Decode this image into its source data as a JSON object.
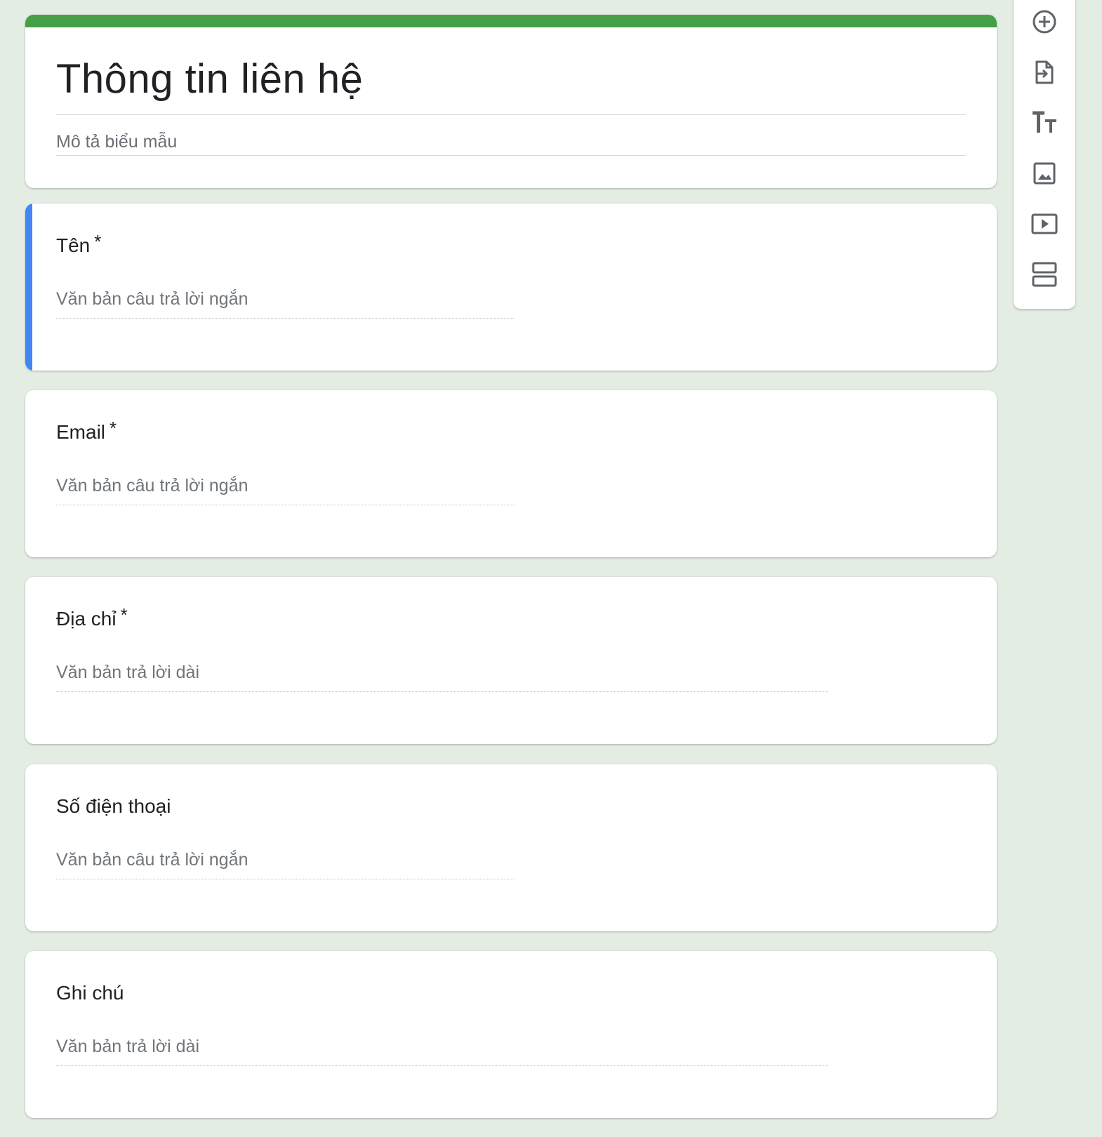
{
  "form": {
    "title": "Thông tin liên hệ",
    "description": "Mô tả biểu mẫu",
    "accent_color": "#43a047",
    "active_color": "#4285f4"
  },
  "questions": [
    {
      "title": "Tên",
      "required_mark": "*",
      "answer_placeholder": "Văn bản câu trả lời ngắn",
      "type": "short"
    },
    {
      "title": "Email",
      "required_mark": "*",
      "answer_placeholder": "Văn bản câu trả lời ngắn",
      "type": "short"
    },
    {
      "title": "Địa chỉ",
      "required_mark": "*",
      "answer_placeholder": "Văn bản trả lời dài",
      "type": "long"
    },
    {
      "title": "Số điện thoại",
      "required_mark": "",
      "answer_placeholder": "Văn bản câu trả lời ngắn",
      "type": "short"
    },
    {
      "title": "Ghi chú",
      "required_mark": "",
      "answer_placeholder": "Văn bản trả lời dài",
      "type": "long"
    }
  ],
  "toolbar": {
    "icons": [
      "add-question-icon",
      "import-questions-icon",
      "add-title-icon",
      "add-image-icon",
      "add-video-icon",
      "add-section-icon"
    ]
  }
}
